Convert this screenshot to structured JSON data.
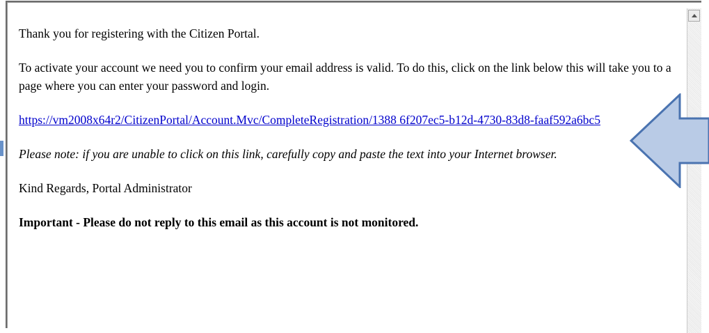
{
  "email": {
    "greeting": "Thank you for registering with the Citizen Portal.",
    "instructions": "To activate your account we need you to confirm your email address is valid. To do this, click on the link below this will take you to a page where you can enter your password and login.",
    "link_text": "https://vm2008x64r2/CitizenPortal/Account.Mvc/CompleteRegistration/1388    6f207ec5-b12d-4730-83d8-faaf592a6bc5",
    "note": "Please note: if you are unable to click on this link, carefully copy and paste the text into your Internet browser.",
    "signoff": "Kind Regards, Portal Administrator",
    "important": "Important - Please do not reply to this email as this account is not monitored."
  },
  "colors": {
    "link": "#0000cc",
    "arrow_fill": "#b9cbe6",
    "arrow_stroke": "#4a73b0"
  },
  "icons": {
    "scroll_up": "triangle-up",
    "callout": "arrow-left"
  }
}
